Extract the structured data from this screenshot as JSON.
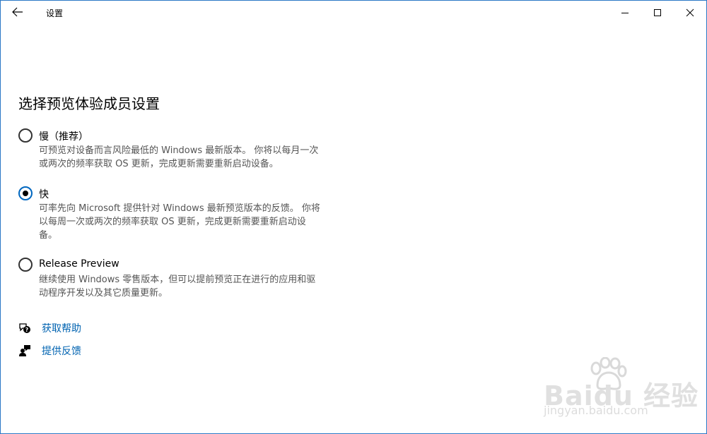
{
  "window": {
    "title": "设置"
  },
  "page": {
    "title": "选择预览体验成员设置"
  },
  "options": [
    {
      "label": "慢（推荐）",
      "checked": false,
      "desc_lines": [
        "可预览对设备而言风险最低的 Windows 最新版本。 你将以每月一次",
        "或两次的频率获取 OS 更新，完成更新需要重新启动设备。"
      ]
    },
    {
      "label": "快",
      "checked": true,
      "desc_lines": [
        "可率先向 Microsoft 提供针对 Windows 最新预览版本的反馈。 你将",
        "以每周一次或两次的频率获取 OS 更新，完成更新需要重新启动设",
        "备。"
      ]
    },
    {
      "label": "Release Preview",
      "checked": false,
      "desc_lines": [
        "继续使用 Windows 零售版本，但可以提前预览正在进行的应用和驱",
        "动程序开发以及其它质量更新。"
      ]
    }
  ],
  "links": {
    "help": "获取帮助",
    "feedback": "提供反馈"
  },
  "watermark": {
    "main": "Baidu 经验",
    "sub": "jingyan.baidu.com"
  },
  "colors": {
    "accent": "#0067c0",
    "link": "#0063b1",
    "window_border": "#2b78c6",
    "description": "#555555"
  }
}
